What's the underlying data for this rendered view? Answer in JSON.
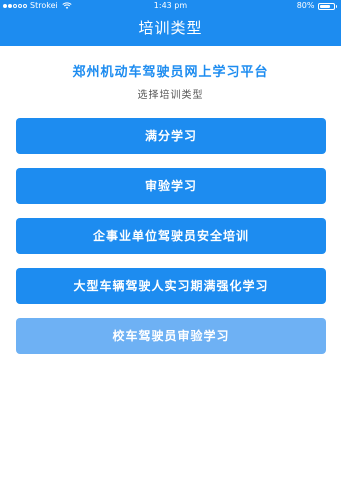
{
  "status_bar": {
    "carrier": "Strokei",
    "time": "1:43 pm",
    "battery": "80%",
    "battery_level": 0.8,
    "signal_icon": "signal-dots-icon",
    "wifi_icon": "wifi-icon",
    "battery_icon": "battery-icon"
  },
  "nav": {
    "title": "培训类型"
  },
  "main": {
    "heading": "郑州机动车驾驶员网上学习平台",
    "subheading": "选择培训类型"
  },
  "buttons": [
    {
      "label": "满分学习"
    },
    {
      "label": "审验学习"
    },
    {
      "label": "企事业单位驾驶员安全培训"
    },
    {
      "label": "大型车辆驾驶人实习期满强化学习"
    },
    {
      "label": "校车驾驶员审验学习"
    }
  ],
  "colors": {
    "primary": "#1d8cf0",
    "primary_light": "#6eb1f4",
    "background": "#ffffff"
  }
}
